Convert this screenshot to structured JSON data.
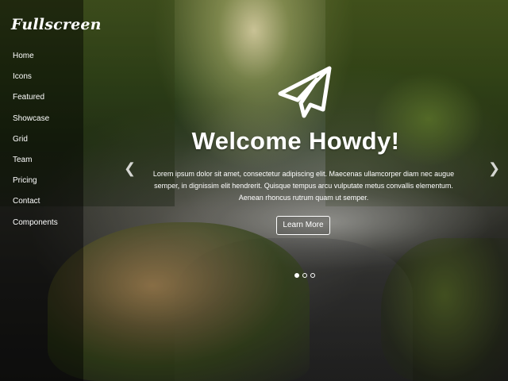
{
  "brand": {
    "name": "Fullscreen"
  },
  "nav": {
    "items": [
      {
        "label": "Home"
      },
      {
        "label": "Icons"
      },
      {
        "label": "Featured"
      },
      {
        "label": "Showcase"
      },
      {
        "label": "Grid"
      },
      {
        "label": "Team"
      },
      {
        "label": "Pricing"
      },
      {
        "label": "Contact"
      },
      {
        "label": "Components"
      }
    ]
  },
  "hero": {
    "icon": "paper-plane-icon",
    "title": "Welcome Howdy!",
    "line1": "Lorem ipsum dolor sit amet, consectetur adipiscing elit. Maecenas ullamcorper diam nec augue",
    "line2": "semper, in dignissim elit hendrerit. Quisque tempus arcu vulputate metus convallis elementum.",
    "line3": "Aenean rhoncus rutrum quam ut semper.",
    "button": "Learn More"
  },
  "carousel": {
    "prev_icon": "chevron-left-icon",
    "next_icon": "chevron-right-icon",
    "prev_glyph": "❮",
    "next_glyph": "❯",
    "slides": 3,
    "active": 1
  }
}
